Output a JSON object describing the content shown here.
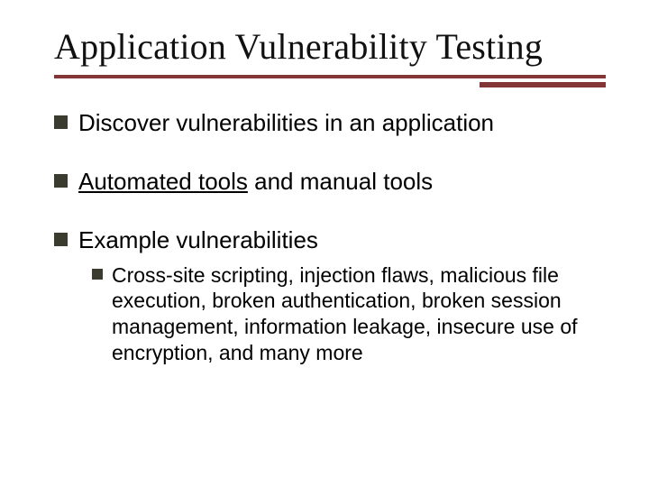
{
  "title": "Application Vulnerability Testing",
  "bullets": [
    {
      "text": "Discover vulnerabilities in an application"
    },
    {
      "underlined": "Automated tools",
      "rest": " and manual tools"
    },
    {
      "text": "Example vulnerabilities",
      "sub": [
        {
          "text": "Cross-site scripting, injection flaws, malicious file execution, broken authentication, broken session management, information leakage, insecure use of encryption, and many more"
        }
      ]
    }
  ],
  "colors": {
    "accent": "#843636",
    "bullet": "#3b3c2f"
  }
}
